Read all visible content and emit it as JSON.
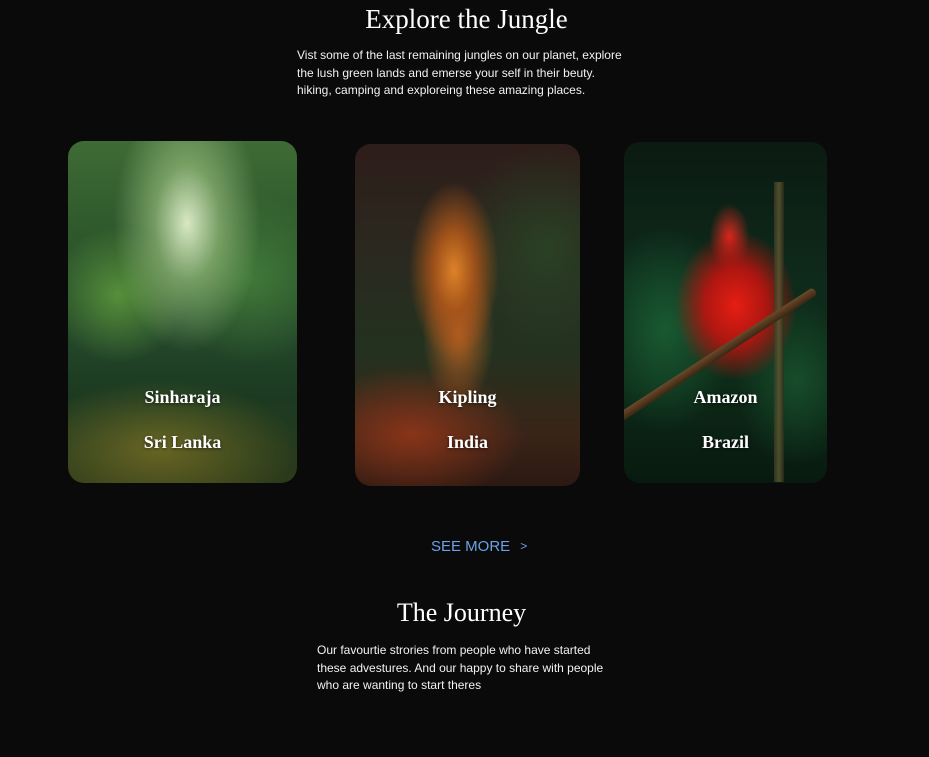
{
  "explore": {
    "title": "Explore the Jungle",
    "description_lines": [
      "Vist some of the last remaining jungles on our planet, explore",
      "the lush green lands and emerse your self in their beuty.",
      "hiking, camping and exploreing these amazing places."
    ]
  },
  "cards": [
    {
      "name": "Sinharaja",
      "country": "Sri Lanka",
      "image": "rainforest-photo"
    },
    {
      "name": "Kipling",
      "country": "India",
      "image": "tiger-photo"
    },
    {
      "name": "Amazon",
      "country": "Brazil",
      "image": "scarlet-ibis-photo"
    }
  ],
  "see_more": {
    "label": "SEE MORE",
    "icon": "chevron-right-icon",
    "color": "#6aa2e6"
  },
  "journey": {
    "title": "The Journey",
    "description_lines": [
      "Our favourtie strories from people who have started",
      "these advestures. And our happy to share with people",
      "who are wanting to start theres"
    ]
  },
  "colors": {
    "background": "#0b0a0b",
    "text": "#ffffff"
  }
}
